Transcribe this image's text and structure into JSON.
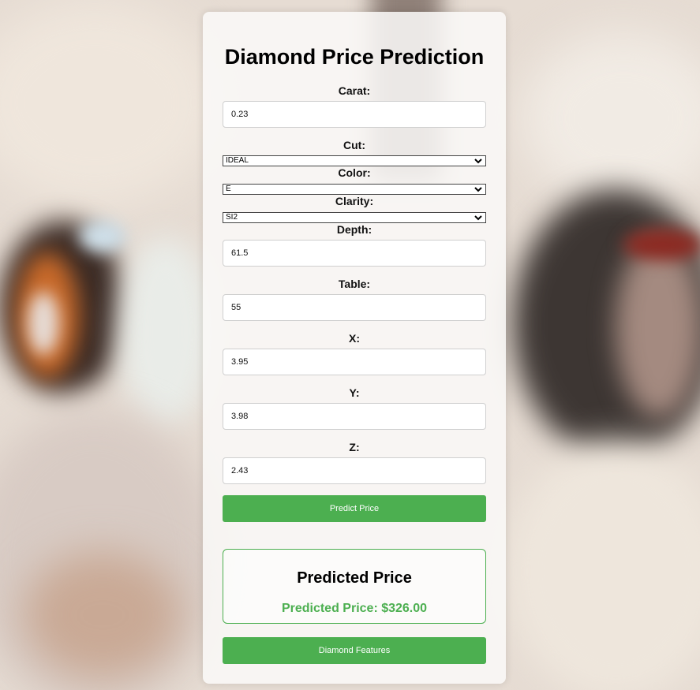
{
  "header": {
    "title": "Diamond Price Prediction"
  },
  "form": {
    "carat": {
      "label": "Carat:",
      "value": "0.23"
    },
    "cut": {
      "label": "Cut:",
      "selected": "IDEAL"
    },
    "color": {
      "label": "Color:",
      "selected": "E"
    },
    "clarity": {
      "label": "Clarity:",
      "selected": "SI2"
    },
    "depth": {
      "label": "Depth:",
      "value": "61.5"
    },
    "table": {
      "label": "Table:",
      "value": "55"
    },
    "x": {
      "label": "X:",
      "value": "3.95"
    },
    "y": {
      "label": "Y:",
      "value": "3.98"
    },
    "z": {
      "label": "Z:",
      "value": "2.43"
    },
    "predict_button": "Predict Price"
  },
  "result": {
    "heading": "Predicted Price",
    "text": "Predicted Price: $326.00"
  },
  "features_button": "Diamond Features",
  "colors": {
    "accent": "#4caf50",
    "panel": "#faf9f8"
  }
}
